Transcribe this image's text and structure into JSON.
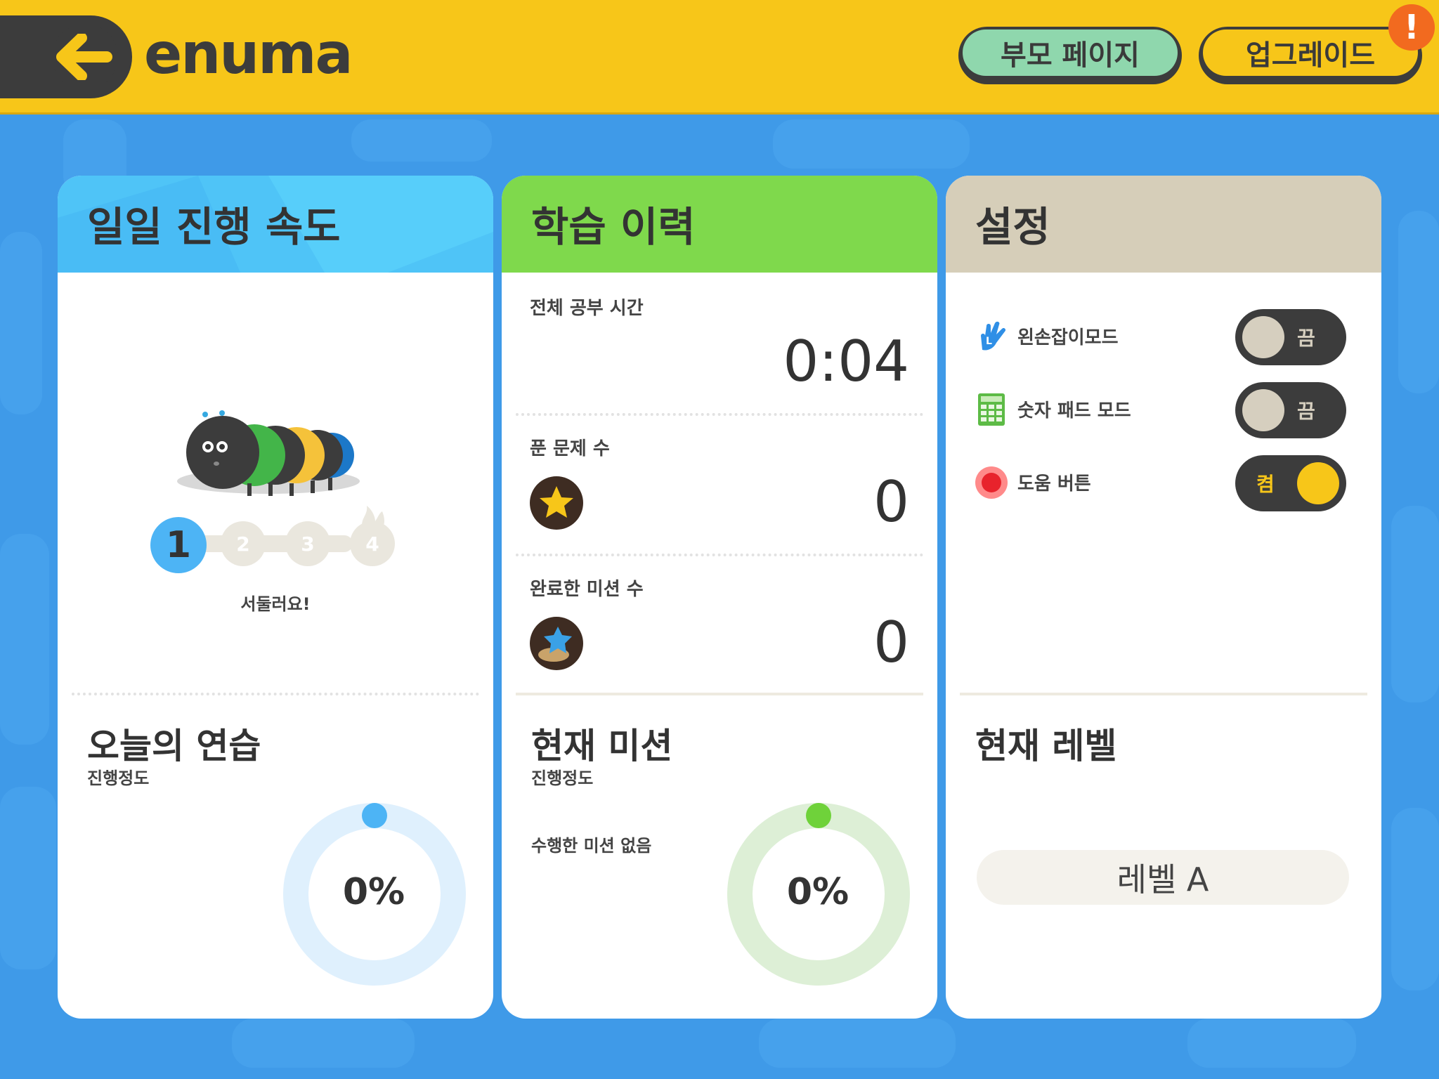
{
  "header": {
    "logo_text": "enuma",
    "parent_page_label": "부모 페이지",
    "upgrade_label": "업그레이드",
    "alert_badge": "!"
  },
  "daily_progress": {
    "title": "일일 진행 속도",
    "steps": [
      "1",
      "2",
      "3",
      "4"
    ],
    "current_step": 1,
    "message": "서둘러요!",
    "practice_title": "오늘의 연습",
    "practice_subtitle": "진행정도",
    "practice_percent": "0%",
    "practice_progress": 0
  },
  "learning_history": {
    "title": "학습 이력",
    "total_time_label": "전체 공부 시간",
    "total_time_value": "0:04",
    "solved_label": "푼 문제 수",
    "solved_value": "0",
    "missions_label": "완료한 미션 수",
    "missions_value": "0",
    "current_mission_title": "현재 미션",
    "current_mission_subtitle": "진행정도",
    "no_mission_text": "수행한 미션 없음",
    "mission_percent": "0%",
    "mission_progress": 0
  },
  "settings": {
    "title": "설정",
    "rows": [
      {
        "label": "왼손잡이모드",
        "state": "끔",
        "on": false,
        "icon": "hand-icon"
      },
      {
        "label": "숫자 패드 모드",
        "state": "끔",
        "on": false,
        "icon": "numpad-icon"
      },
      {
        "label": "도움 버튼",
        "state": "켬",
        "on": true,
        "icon": "help-button-icon"
      }
    ],
    "level_title": "현재 레벨",
    "level_value": "레벨 A"
  },
  "colors": {
    "header_bg": "#f7c619",
    "background": "#3f9ae8",
    "card1_head": "#4fc4f7",
    "card2_head": "#7fd94c",
    "card3_head": "#d6ceb9",
    "dark": "#3c3c3c",
    "parent_btn": "#8fd7ad",
    "alert": "#f26a1f"
  }
}
